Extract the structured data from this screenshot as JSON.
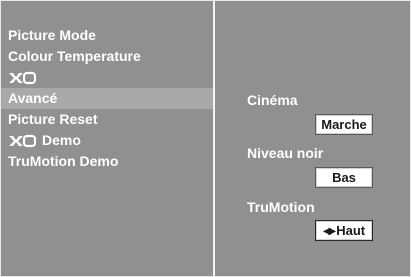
{
  "menu": {
    "items": [
      {
        "label": "Picture Mode"
      },
      {
        "label": "Colour Temperature"
      },
      {
        "label": "",
        "logo": "xd-logo"
      },
      {
        "label": "Avancé",
        "selected": true
      },
      {
        "label": "Picture Reset"
      },
      {
        "label": "Demo",
        "logo": "xd-logo"
      },
      {
        "label": "TruMotion Demo"
      }
    ]
  },
  "settings": {
    "cinema": {
      "label": "Cinéma",
      "value": "Marche"
    },
    "niveau_noir": {
      "label": "Niveau noir",
      "value": "Bas"
    },
    "trumotion": {
      "label": "TruMotion",
      "value": "Haut",
      "arrows_icon": "left-right-arrows-icon"
    }
  },
  "colors": {
    "osd_background": "#909092",
    "selected_row": "#a9a9ab",
    "text": "#ffffff",
    "value_box": "#ffffff"
  }
}
